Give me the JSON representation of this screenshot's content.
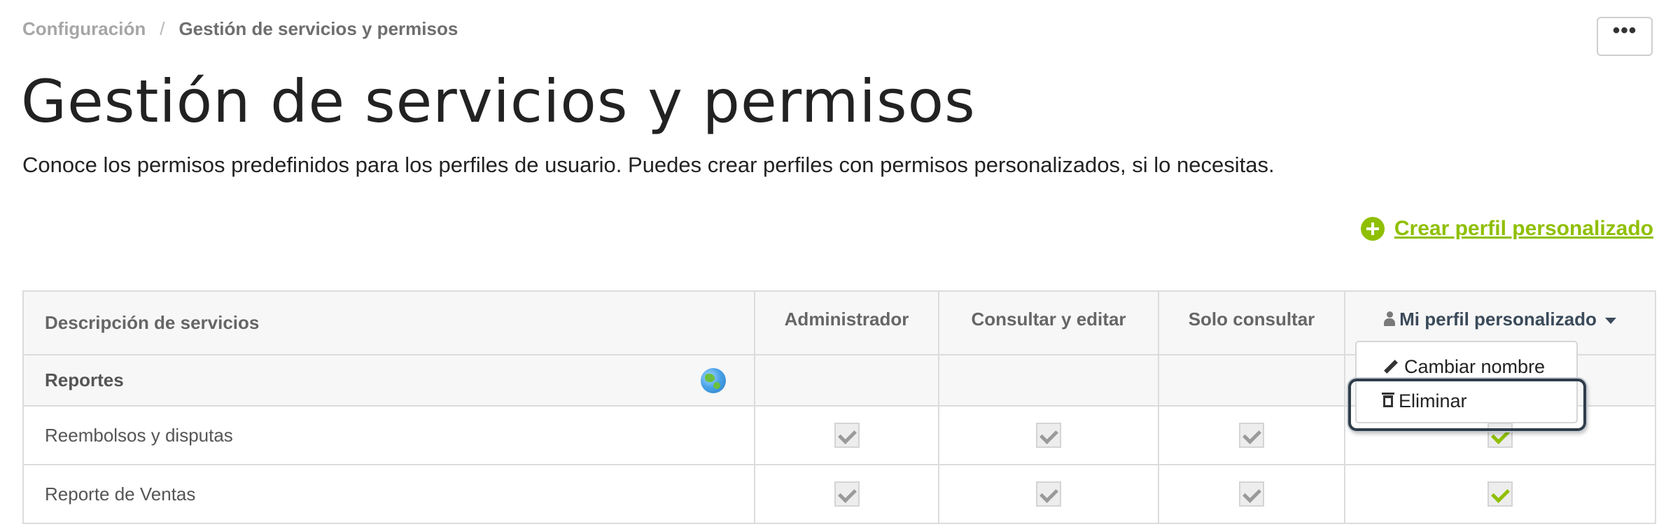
{
  "breadcrumb": {
    "parent": "Configuración",
    "separator": "/",
    "current": "Gestión de servicios y permisos"
  },
  "more_button": {
    "label": "•••",
    "icon": "ellipsis-icon"
  },
  "header": {
    "title": "Gestión de servicios y permisos",
    "description": "Conoce los permisos predefinidos para los perfiles de usuario. Puedes crear perfiles con permisos personalizados, si lo necesitas."
  },
  "create_profile": {
    "label": "Crear perfil personalizado",
    "icon": "plus-circle-icon",
    "color": "#8fbf00"
  },
  "table": {
    "columns": [
      "Descripción de servicios",
      "Administrador",
      "Consultar y editar",
      "Solo consultar",
      "Mi perfil personalizado"
    ],
    "section": {
      "label": "Reportes",
      "icon": "globe-icon"
    },
    "rows": [
      {
        "name": "Reembolsos y disputas",
        "checks": [
          true,
          true,
          true,
          true
        ]
      },
      {
        "name": "Reporte de Ventas",
        "checks": [
          true,
          true,
          true,
          true
        ]
      }
    ]
  },
  "profile_menu": {
    "items": [
      {
        "label": "Cambiar nombre",
        "icon": "pencil-icon"
      },
      {
        "label": "Eliminar",
        "icon": "trash-icon"
      }
    ]
  },
  "colors": {
    "accent": "#8fbf00",
    "highlight": "#2f3d4a"
  }
}
